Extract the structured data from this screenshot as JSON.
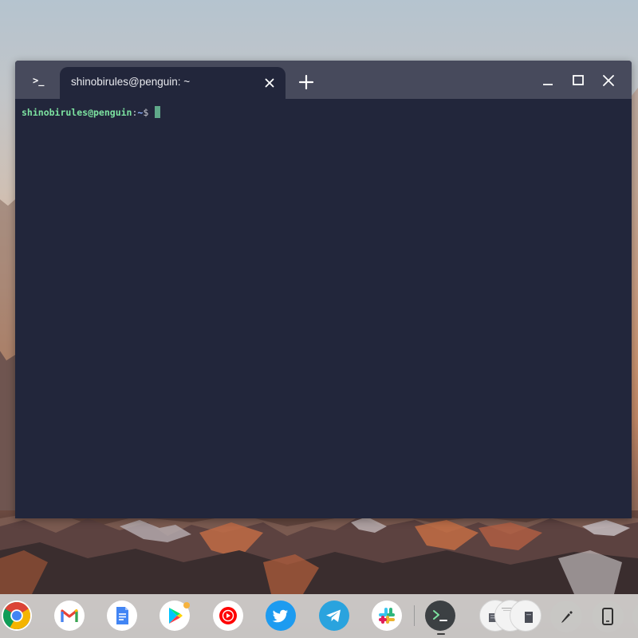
{
  "terminal": {
    "app_icon_label": ">_",
    "tab_title": "shinobirules@penguin: ~",
    "prompt": {
      "user_host": "shinobirules@penguin",
      "separator": ":",
      "path": "~",
      "symbol": "$"
    }
  },
  "shelf": {
    "apps": [
      {
        "name": "Chrome",
        "icon": "chrome-icon"
      },
      {
        "name": "Gmail",
        "icon": "gmail-icon"
      },
      {
        "name": "Google Docs",
        "icon": "docs-icon"
      },
      {
        "name": "Play Store",
        "icon": "play-store-icon"
      },
      {
        "name": "YouTube Music",
        "icon": "youtube-music-icon"
      },
      {
        "name": "Twitter",
        "icon": "twitter-icon"
      },
      {
        "name": "Telegram",
        "icon": "telegram-icon"
      },
      {
        "name": "Slack",
        "icon": "slack-icon"
      },
      {
        "name": "Terminal",
        "icon": "terminal-icon",
        "active": true
      }
    ],
    "tray": [
      "holding-space",
      "stylus-tools-icon",
      "phone-hub-icon"
    ]
  },
  "colors": {
    "terminal_bg": "#22263b",
    "titlebar_bg": "#474a5c",
    "prompt_green": "#7de3a1",
    "prompt_blue": "#8fb2ff",
    "cursor": "#5fa889"
  }
}
